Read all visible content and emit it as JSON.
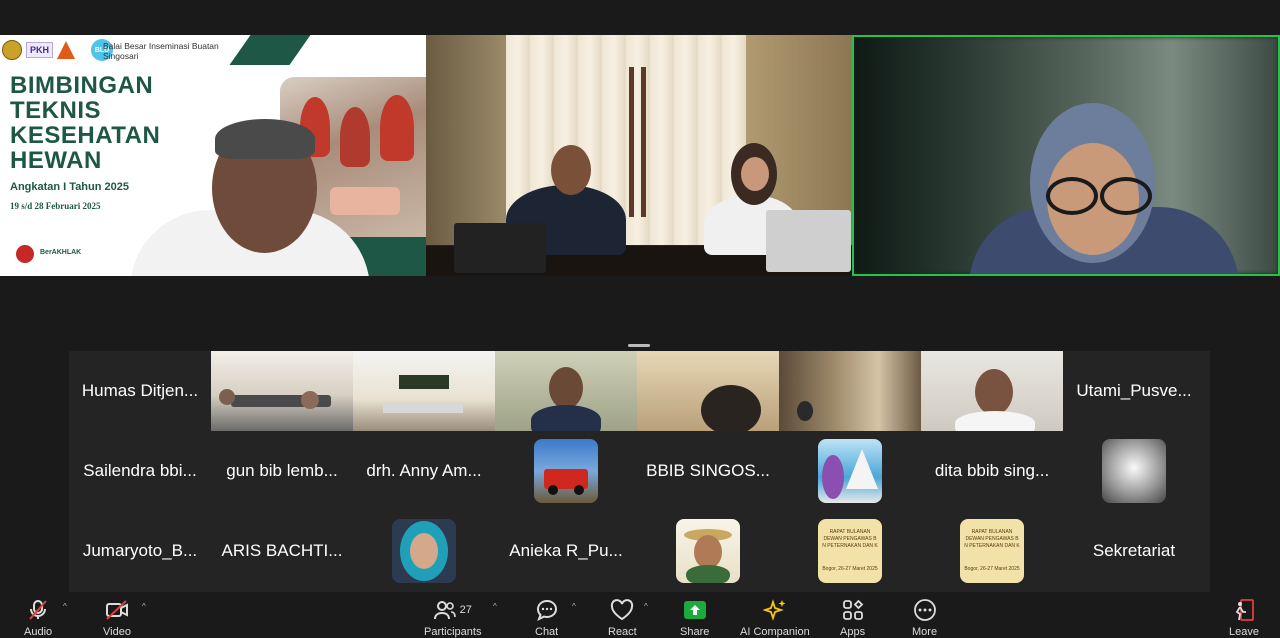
{
  "main_tiles": {
    "slide": {
      "org": "Balai Besar Inseminasi Buatan Singosari",
      "logo_text": "PKH",
      "logo_blu": "BLU",
      "title_lines": [
        "BIMBINGAN",
        "TEKNIS",
        "KESEHATAN",
        "HEWAN"
      ],
      "subtitle": "Angkatan I Tahun 2025",
      "date": "19 s/d 28 Februari 2025",
      "brand": "BerAKHLAK"
    }
  },
  "gallery": {
    "row1": [
      {
        "name": "Humas Ditjen...",
        "type": "name"
      },
      {
        "name": "",
        "type": "cam",
        "scene": "meeting-room"
      },
      {
        "name": "",
        "type": "cam",
        "scene": "balai-besar"
      },
      {
        "name": "",
        "type": "cam",
        "scene": "man-suit"
      },
      {
        "name": "",
        "type": "cam",
        "scene": "woman-hijab"
      },
      {
        "name": "",
        "type": "cam",
        "scene": "room-window"
      },
      {
        "name": "",
        "type": "cam",
        "scene": "man-office"
      },
      {
        "name": "Utami_Pusve...",
        "type": "name"
      }
    ],
    "row2": [
      {
        "name": "Sailendra bbi...",
        "type": "name"
      },
      {
        "name": "gun bib lemb...",
        "type": "name"
      },
      {
        "name": "drh. Anny Am...",
        "type": "name"
      },
      {
        "name": "",
        "type": "avatar",
        "avatar": "red-jeep"
      },
      {
        "name": "BBIB SINGOS...",
        "type": "name"
      },
      {
        "name": "",
        "type": "avatar",
        "avatar": "woman-sails"
      },
      {
        "name": "dita bbib sing...",
        "type": "name"
      },
      {
        "name": "",
        "type": "avatar",
        "avatar": "blurred"
      }
    ],
    "row3": [
      {
        "name": "Jumaryoto_B...",
        "type": "name"
      },
      {
        "name": "ARIS BACHTI...",
        "type": "name"
      },
      {
        "name": "",
        "type": "avatar",
        "avatar": "woman-teal-hijab"
      },
      {
        "name": "Anieka R_Pu...",
        "type": "name"
      },
      {
        "name": "",
        "type": "avatar",
        "avatar": "man-hat"
      },
      {
        "name": "",
        "type": "avatar",
        "avatar": "rapat-bulanan"
      },
      {
        "name": "",
        "type": "avatar",
        "avatar": "rapat-bulanan"
      },
      {
        "name": "Sekretariat",
        "type": "name"
      }
    ],
    "poster": {
      "line1": "RAPAT BULANAN",
      "line2": "DEWAN PENGAWAS B",
      "line3": "N PETERNAKAN DAN K",
      "line4": "Bogor, 26-27 Maret 2025"
    }
  },
  "toolbar": {
    "audio": "Audio",
    "video": "Video",
    "participants": "Participants",
    "participants_count": "27",
    "chat": "Chat",
    "react": "React",
    "share": "Share",
    "ai": "AI Companion",
    "apps": "Apps",
    "more": "More",
    "leave": "Leave"
  },
  "colors": {
    "active_speaker": "#29c14a",
    "share_green": "#1aaa3e",
    "muted_red": "#e0403a",
    "ai_yellow": "#f5c518"
  }
}
